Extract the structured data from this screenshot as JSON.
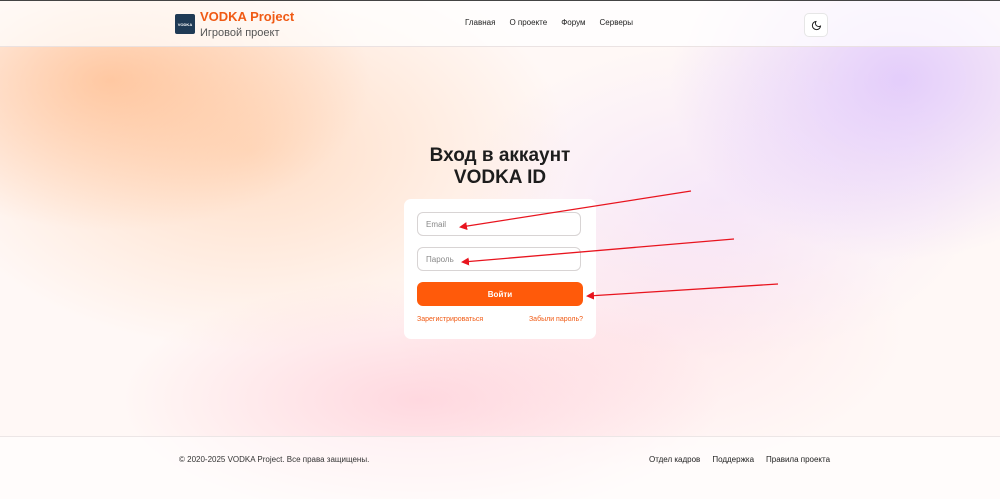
{
  "header": {
    "brand_title": "VODKA Project",
    "brand_subtitle": "Игровой проект",
    "logo_text": "VODKA",
    "nav": [
      "Главная",
      "О проекте",
      "Форум",
      "Серверы"
    ],
    "theme_icon": "moon-icon"
  },
  "login": {
    "title_line1": "Вход в аккаунт",
    "title_line2": "VODKA ID",
    "email_placeholder": "Email",
    "password_placeholder": "Пароль",
    "submit_label": "Войти",
    "register_link": "Зарегистрироваться",
    "forgot_link": "Забыли пароль?"
  },
  "footer": {
    "copyright": "© 2020-2025 VODKA Project. Все права защищены.",
    "links": [
      "Отдел кадров",
      "Поддержка",
      "Правила проекта"
    ]
  },
  "colors": {
    "accent": "#ff5a0a",
    "annotation_arrow": "#e8141e"
  }
}
